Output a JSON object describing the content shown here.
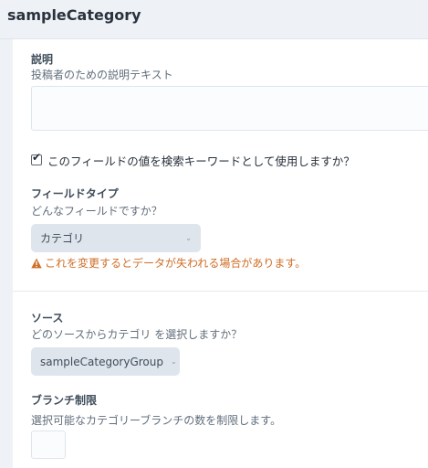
{
  "header": {
    "title": "sampleCategory"
  },
  "fields": {
    "description": {
      "label": "説明",
      "instructions": "投稿者のための説明テキスト",
      "value": ""
    },
    "search_keywords": {
      "checked": true,
      "label": "このフィールドの値を検索キーワードとして使用しますか？"
    },
    "field_type": {
      "label": "フィールドタイプ",
      "instructions": "どんなフィールドですか？",
      "selected": "カテゴリ",
      "warning": "これを変更するとデータが失われる場合があります。"
    },
    "source": {
      "label": "ソース",
      "instructions": "どのソースからカテゴリ を選択しますか？",
      "selected": "sampleCategoryGroup"
    },
    "branch_limit": {
      "label": "ブランチ制限",
      "instructions": "選択可能なカテゴリーブランチの数を制限します。",
      "value": ""
    }
  },
  "colors": {
    "warning": "#cf6e27",
    "select_bg": "#dfe5ec",
    "page_bg": "#eef2f6"
  },
  "icons": {
    "checkbox": "checkmark-icon",
    "warning": "warning-triangle-icon",
    "dropdown": "chevron-down-icon"
  }
}
